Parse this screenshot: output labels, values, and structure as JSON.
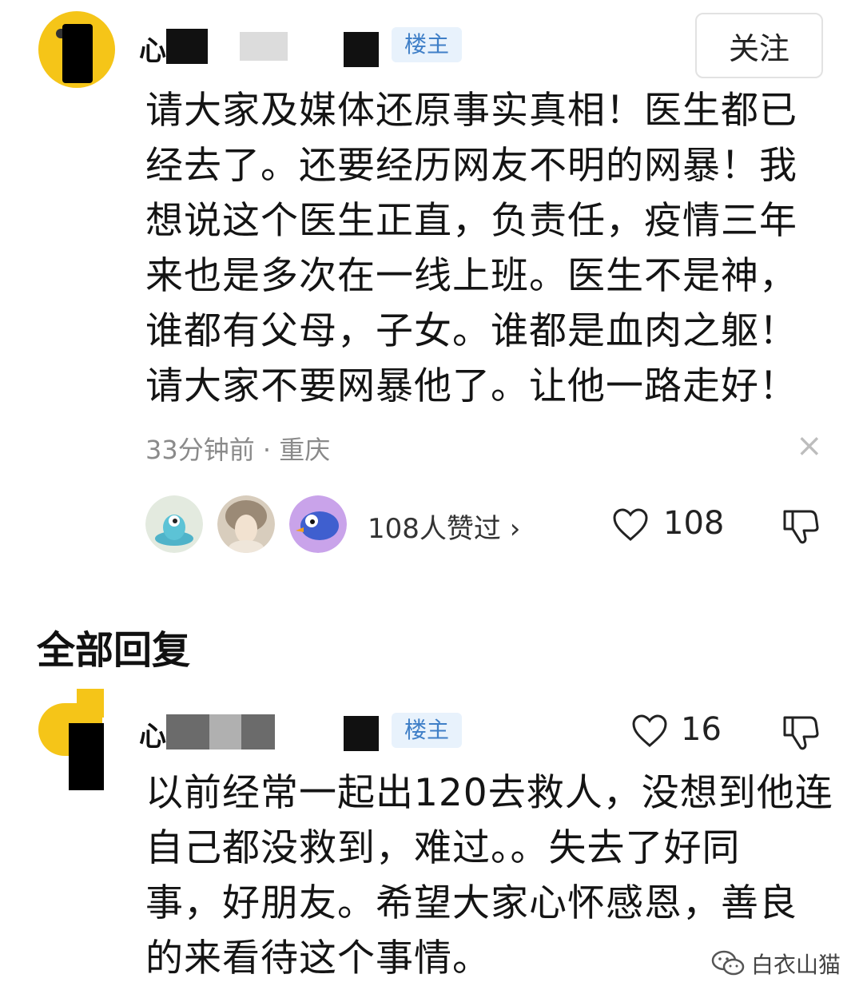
{
  "post": {
    "username_visible": "心",
    "badge": "楼主",
    "follow_label": "关注",
    "lines": [
      "请大家及媒体还原事实真相！医生都已",
      "经去了。还要经历网友不明的网暴！我",
      "想说这个医生正直，负责任，疫情三年",
      "来也是多次在一线上班。医生不是神，",
      "谁都有父母，子女。谁都是血肉之躯！",
      "请大家不要网暴他了。让他一路走好！"
    ],
    "meta": "33分钟前 · 重庆",
    "close_icon": "×",
    "likers_label": "108人赞过 ›",
    "like_count": "108"
  },
  "replies_section": {
    "title": "全部回复"
  },
  "reply": {
    "username_visible": "心",
    "badge": "楼主",
    "like_count": "16",
    "lines": [
      "以前经常一起出120去救人，没想到他连",
      "自己都没救到，难过。。失去了好同",
      "事，好朋友。希望大家心怀感恩，善良",
      "的来看待这个事情。"
    ]
  },
  "watermark": {
    "text": "白衣山猫"
  },
  "colors": {
    "badge_bg": "#e8f2fc",
    "badge_text": "#3f7fc7",
    "avatar_yellow": "#f5c518"
  }
}
